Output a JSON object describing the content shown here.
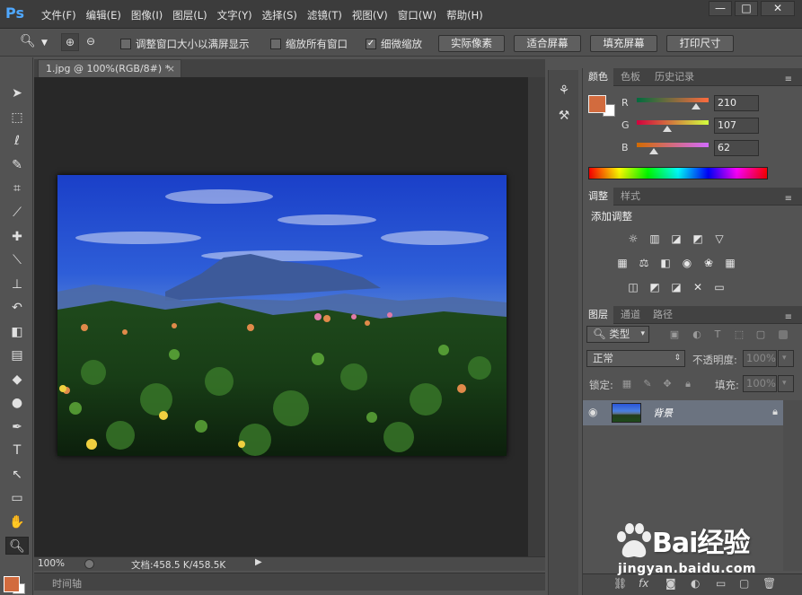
{
  "app": {
    "logo": "Ps"
  },
  "menu": [
    "文件(F)",
    "编辑(E)",
    "图像(I)",
    "图层(L)",
    "文字(Y)",
    "选择(S)",
    "滤镜(T)",
    "视图(V)",
    "窗口(W)",
    "帮助(H)"
  ],
  "window_buttons": {
    "minimize": "—",
    "maximize": "□",
    "close": "✕"
  },
  "options": {
    "resize_windows": "调整窗口大小以满屏显示",
    "zoom_all": "缩放所有窗口",
    "scrubby_zoom": "细微缩放",
    "resize_checked": false,
    "zoom_all_checked": false,
    "scrubby_checked": true,
    "btn_actual": "实际像素",
    "btn_fit": "适合屏幕",
    "btn_fill": "填充屏幕",
    "btn_print": "打印尺寸"
  },
  "document": {
    "tab": "1.jpg @ 100%(RGB/8#) *",
    "tab_close": "×",
    "zoom": "100%",
    "info": "文档:458.5 K/458.5K",
    "timeline": "时间轴"
  },
  "color_panel": {
    "tabs": [
      "颜色",
      "色板",
      "历史记录"
    ],
    "r_label": "R",
    "g_label": "G",
    "b_label": "B",
    "r": "210",
    "g": "107",
    "b": "62",
    "r_level": 0.82,
    "g_level": 0.42,
    "b_level": 0.24,
    "fg_color": "#d26b3e"
  },
  "adjust_panel": {
    "tabs": [
      "调整",
      "样式"
    ],
    "title": "添加调整"
  },
  "layers_panel": {
    "tabs": [
      "图层",
      "通道",
      "路径"
    ],
    "filter": "类型",
    "blend": "正常",
    "opacity_label": "不透明度:",
    "opacity": "100%",
    "lock_label": "锁定:",
    "fill_label": "填充:",
    "fill": "100%",
    "layer_name": "背景"
  },
  "watermark": {
    "brand": "Bai经验",
    "url": "jingyan.baidu.com"
  }
}
